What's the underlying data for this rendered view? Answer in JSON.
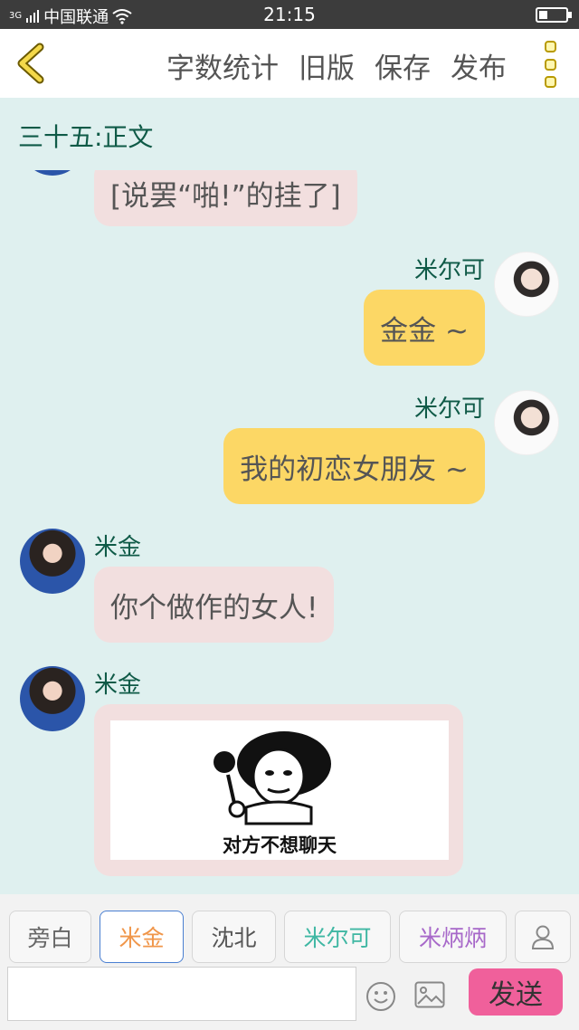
{
  "status_bar": {
    "signal": "3G",
    "carrier": "中国联通",
    "time": "21:15"
  },
  "header": {
    "back_icon": "chevron-left-icon",
    "actions": [
      "字数统计",
      "旧版",
      "保存",
      "发布"
    ],
    "menu_icon": "more-vertical-icon"
  },
  "chapter_title": "三十五:正文",
  "messages": [
    {
      "text": "[说罢“啪!”的挂了]"
    },
    {
      "sender": "米尔可",
      "text": "金金 ~"
    },
    {
      "sender": "米尔可",
      "text": "我的初恋女朋友 ~"
    },
    {
      "sender": "米金",
      "text": "你个做作的女人!"
    },
    {
      "sender": "米金",
      "sticker_caption": "对方不想聊天"
    }
  ],
  "roles": [
    {
      "label": "旁白",
      "color": "#666666"
    },
    {
      "label": "米金",
      "color": "#f0964a"
    },
    {
      "label": "沈北",
      "color": "#555555"
    },
    {
      "label": "米尔可",
      "color": "#3fb7a3"
    },
    {
      "label": "米炳炳",
      "color": "#a768c9"
    }
  ],
  "input": {
    "value": "",
    "placeholder": ""
  },
  "send_label": "发送",
  "icons": [
    "person-icon",
    "emoji-icon",
    "image-icon"
  ]
}
